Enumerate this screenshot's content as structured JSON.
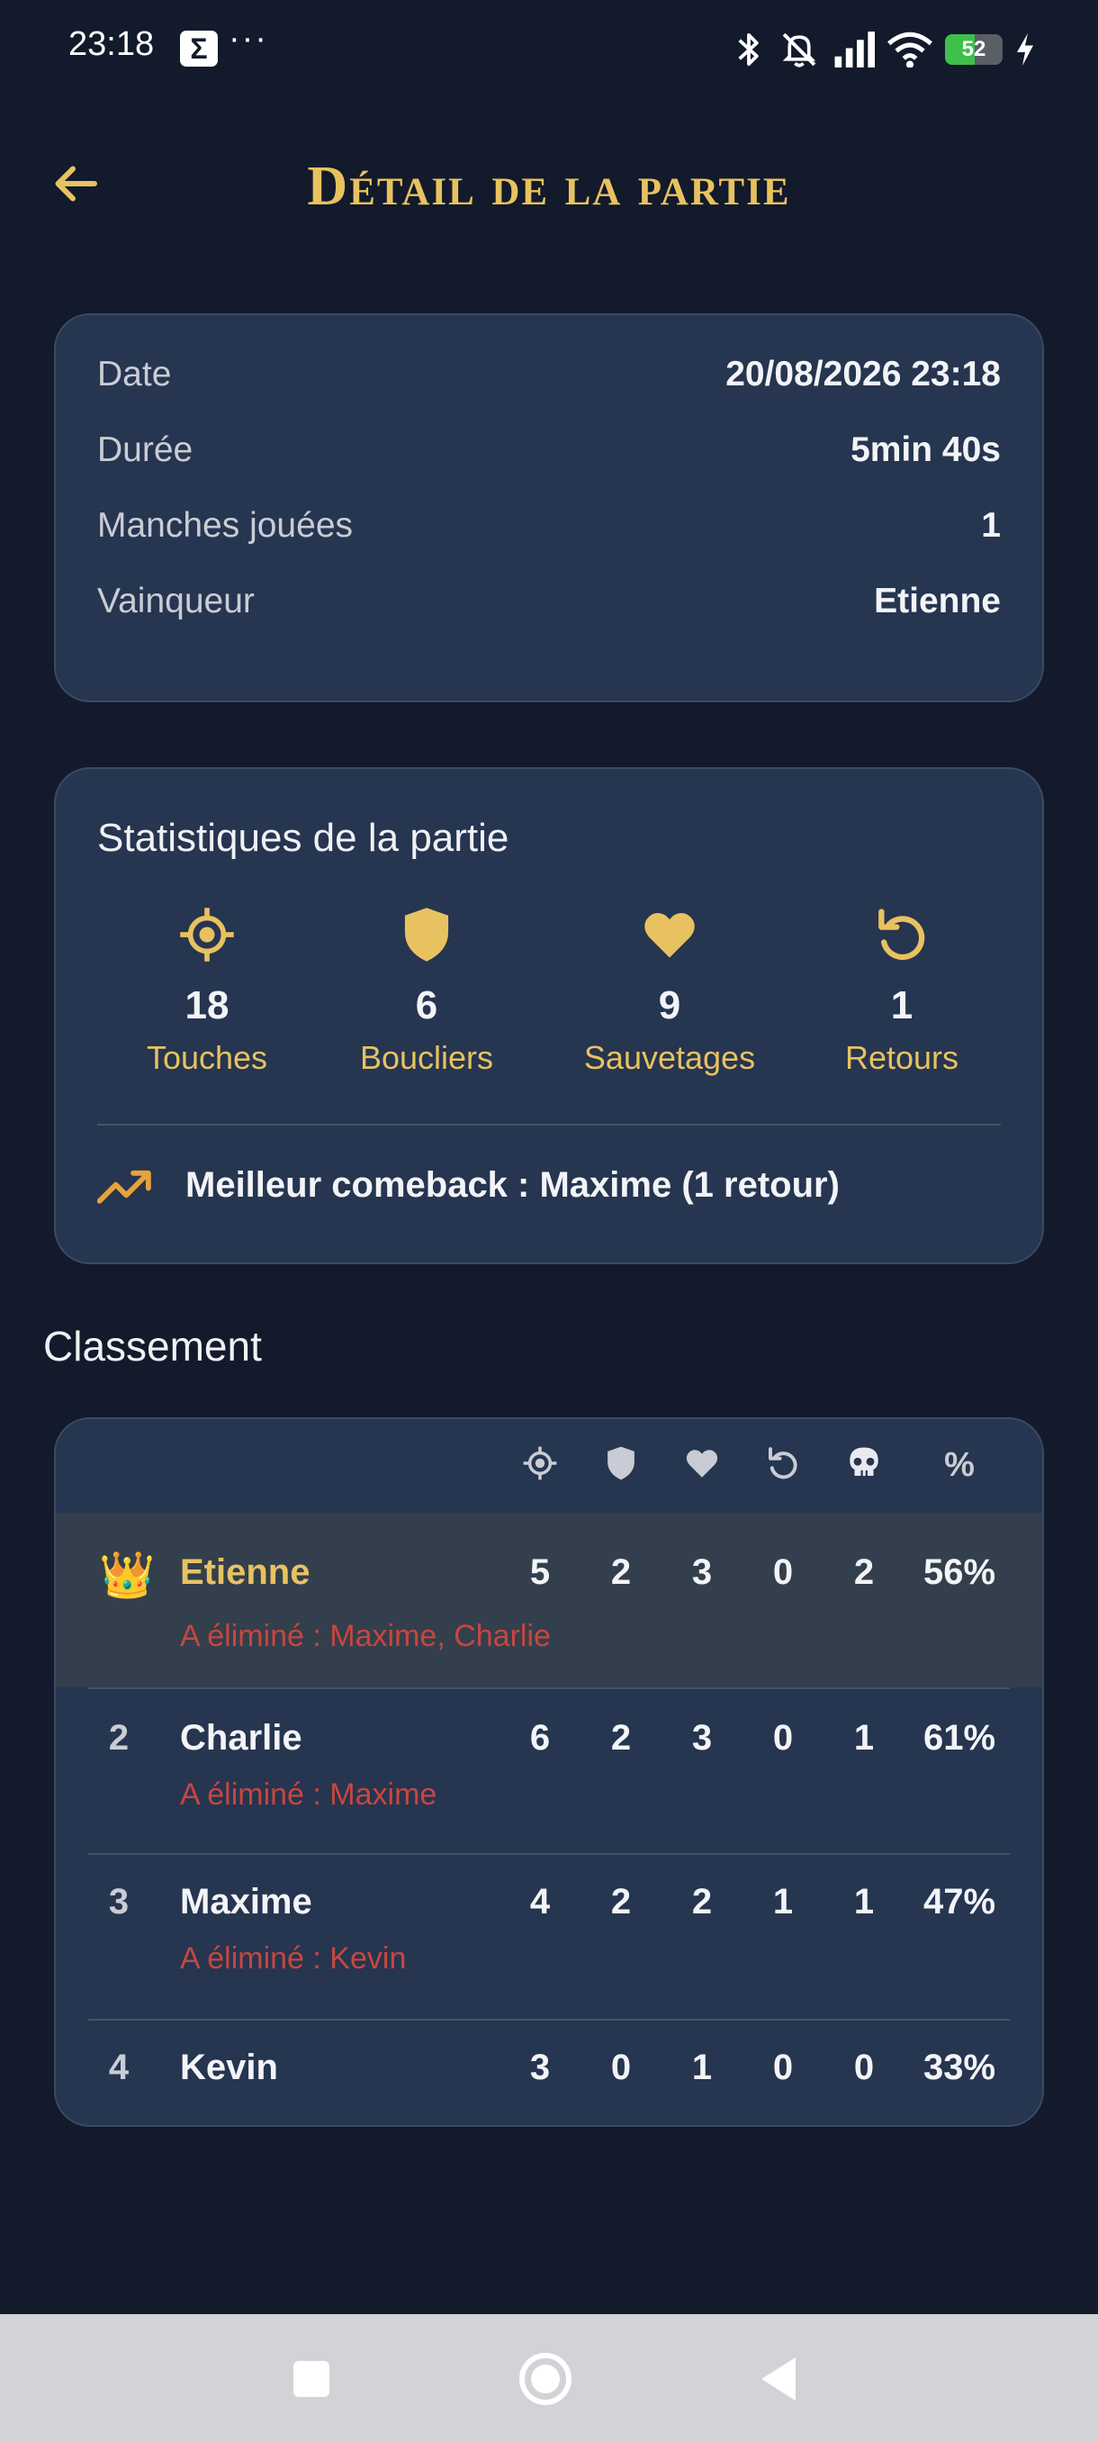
{
  "status_bar": {
    "time": "23:18",
    "sigma_glyph": "Σ",
    "more_glyph": "···",
    "battery_percent": "52",
    "battery_level": 0.52,
    "icons": [
      "bluetooth-icon",
      "bell-off-icon",
      "signal-icon",
      "wifi-icon",
      "battery-icon",
      "charging-icon"
    ]
  },
  "header": {
    "title": "Détail de la partie",
    "back_icon": "arrow-left-icon"
  },
  "colors": {
    "background": "#121a2b",
    "card": "#263550",
    "accent_gold": "#e8c260",
    "elimination_red": "#c8463f",
    "winner_row": "#333f4c"
  },
  "game_info": {
    "rows": [
      {
        "label": "Date",
        "value": "20/08/2026 23:18"
      },
      {
        "label": "Durée",
        "value": "5min 40s"
      },
      {
        "label": "Manches jouées",
        "value": "1"
      },
      {
        "label": "Vainqueur",
        "value": "Etienne"
      }
    ]
  },
  "game_stats": {
    "title": "Statistiques de la partie",
    "items": [
      {
        "icon": "target-icon",
        "value": "18",
        "label": "Touches"
      },
      {
        "icon": "shield-icon",
        "value": "6",
        "label": "Boucliers"
      },
      {
        "icon": "heart-icon",
        "value": "9",
        "label": "Sauvetages"
      },
      {
        "icon": "undo-icon",
        "value": "1",
        "label": "Retours"
      }
    ],
    "comeback_icon": "trending-up-icon",
    "comeback_text": "Meilleur comeback : Maxime (1 retour)"
  },
  "ranking": {
    "title": "Classement",
    "columns": [
      {
        "icon": "target-icon"
      },
      {
        "icon": "shield-icon"
      },
      {
        "icon": "heart-icon"
      },
      {
        "icon": "undo-icon"
      },
      {
        "icon": "skull-icon"
      },
      {
        "label": "%"
      }
    ],
    "players": [
      {
        "rank": "",
        "crown": "👑",
        "name": "Etienne",
        "eliminated": "A éliminé : Maxime, Charlie",
        "stats": [
          "5",
          "2",
          "3",
          "0",
          "2",
          "56%"
        ]
      },
      {
        "rank": "2",
        "name": "Charlie",
        "eliminated": "A éliminé : Maxime",
        "stats": [
          "6",
          "2",
          "3",
          "0",
          "1",
          "61%"
        ]
      },
      {
        "rank": "3",
        "name": "Maxime",
        "eliminated": "A éliminé : Kevin",
        "stats": [
          "4",
          "2",
          "2",
          "1",
          "1",
          "47%"
        ]
      },
      {
        "rank": "4",
        "name": "Kevin",
        "eliminated": "",
        "stats": [
          "3",
          "0",
          "1",
          "0",
          "0",
          "33%"
        ]
      }
    ]
  },
  "nav_bar": {
    "buttons": [
      "recent-apps-icon",
      "home-icon",
      "back-icon"
    ]
  }
}
